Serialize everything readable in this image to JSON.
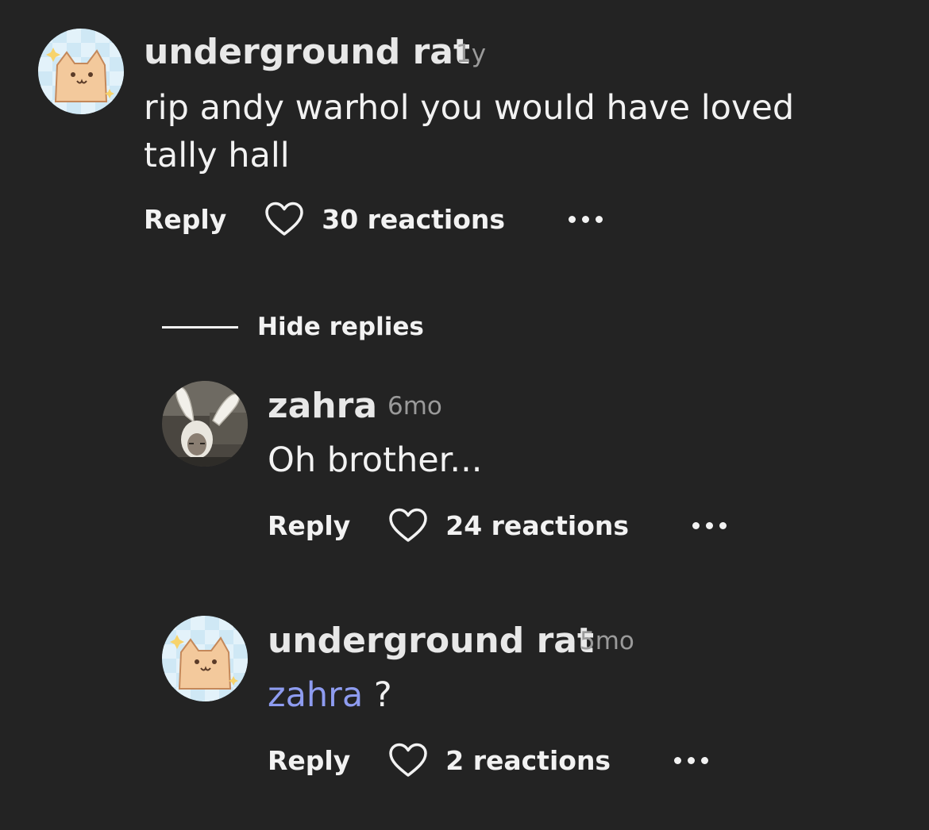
{
  "comments": [
    {
      "username": "underground rat",
      "time": "1y",
      "text": "rip andy warhol you would have loved tally hall",
      "reply_label": "Reply",
      "reactions": "30 reactions"
    }
  ],
  "thread": {
    "hide_replies_label": "Hide replies",
    "replies": [
      {
        "username": "zahra",
        "time": "6mo",
        "text": "Oh brother...",
        "reply_label": "Reply",
        "reactions": "24 reactions"
      },
      {
        "username": "underground rat",
        "time": "5mo",
        "mention": "zahra",
        "text": " ?",
        "reply_label": "Reply",
        "reactions": "2 reactions"
      }
    ]
  },
  "colors": {
    "background": "#232323",
    "mention": "#8e9cf0",
    "muted": "#9a9a9a"
  },
  "icons": {
    "heart": "heart-icon",
    "more": "more-options-icon"
  }
}
